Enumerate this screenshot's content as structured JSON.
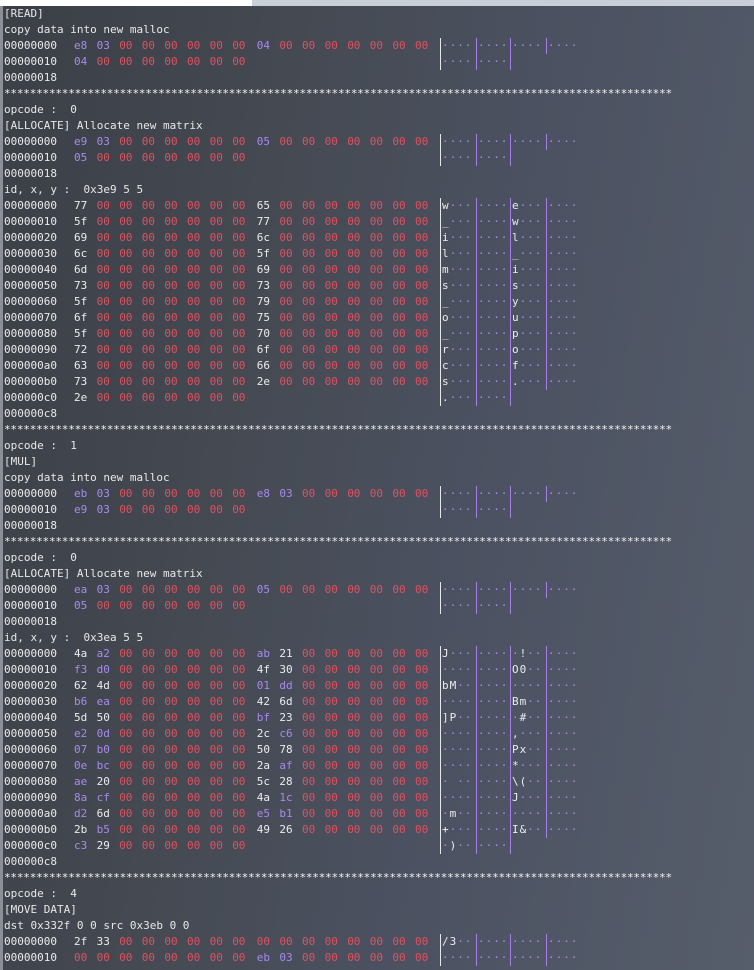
{
  "colors": {
    "zero": "#e0505e",
    "purple": "#a889ee",
    "white": "#ececec"
  },
  "lines": [
    {
      "type": "text",
      "text": "[READ]"
    },
    {
      "type": "text",
      "text": "copy data into new malloc"
    },
    {
      "type": "hex",
      "addr": "00000000",
      "bytes": [
        "e8",
        "03",
        "00",
        "00",
        "00",
        "00",
        "00",
        "00",
        "04",
        "00",
        "00",
        "00",
        "00",
        "00",
        "00",
        "00"
      ],
      "ascii": "................"
    },
    {
      "type": "hex",
      "addr": "00000010",
      "bytes": [
        "04",
        "00",
        "00",
        "00",
        "00",
        "00",
        "00",
        "00"
      ],
      "ascii": "........"
    },
    {
      "type": "text",
      "text": "00000018"
    },
    {
      "type": "stars"
    },
    {
      "type": "text",
      "text": "opcode :  0"
    },
    {
      "type": "text",
      "text": "[ALLOCATE] Allocate new matrix"
    },
    {
      "type": "hex",
      "addr": "00000000",
      "bytes": [
        "e9",
        "03",
        "00",
        "00",
        "00",
        "00",
        "00",
        "00",
        "05",
        "00",
        "00",
        "00",
        "00",
        "00",
        "00",
        "00"
      ],
      "ascii": "................"
    },
    {
      "type": "hex",
      "addr": "00000010",
      "bytes": [
        "05",
        "00",
        "00",
        "00",
        "00",
        "00",
        "00",
        "00"
      ],
      "ascii": "........"
    },
    {
      "type": "text",
      "text": "00000018"
    },
    {
      "type": "text",
      "text": "id, x, y :  0x3e9 5 5"
    },
    {
      "type": "hex",
      "addr": "00000000",
      "bytes": [
        "77",
        "00",
        "00",
        "00",
        "00",
        "00",
        "00",
        "00",
        "65",
        "00",
        "00",
        "00",
        "00",
        "00",
        "00",
        "00"
      ],
      "ascii": "w.......e......."
    },
    {
      "type": "hex",
      "addr": "00000010",
      "bytes": [
        "5f",
        "00",
        "00",
        "00",
        "00",
        "00",
        "00",
        "00",
        "77",
        "00",
        "00",
        "00",
        "00",
        "00",
        "00",
        "00"
      ],
      "ascii": "_.......w......."
    },
    {
      "type": "hex",
      "addr": "00000020",
      "bytes": [
        "69",
        "00",
        "00",
        "00",
        "00",
        "00",
        "00",
        "00",
        "6c",
        "00",
        "00",
        "00",
        "00",
        "00",
        "00",
        "00"
      ],
      "ascii": "i.......l......."
    },
    {
      "type": "hex",
      "addr": "00000030",
      "bytes": [
        "6c",
        "00",
        "00",
        "00",
        "00",
        "00",
        "00",
        "00",
        "5f",
        "00",
        "00",
        "00",
        "00",
        "00",
        "00",
        "00"
      ],
      "ascii": "l......._......."
    },
    {
      "type": "hex",
      "addr": "00000040",
      "bytes": [
        "6d",
        "00",
        "00",
        "00",
        "00",
        "00",
        "00",
        "00",
        "69",
        "00",
        "00",
        "00",
        "00",
        "00",
        "00",
        "00"
      ],
      "ascii": "m.......i......."
    },
    {
      "type": "hex",
      "addr": "00000050",
      "bytes": [
        "73",
        "00",
        "00",
        "00",
        "00",
        "00",
        "00",
        "00",
        "73",
        "00",
        "00",
        "00",
        "00",
        "00",
        "00",
        "00"
      ],
      "ascii": "s.......s......."
    },
    {
      "type": "hex",
      "addr": "00000060",
      "bytes": [
        "5f",
        "00",
        "00",
        "00",
        "00",
        "00",
        "00",
        "00",
        "79",
        "00",
        "00",
        "00",
        "00",
        "00",
        "00",
        "00"
      ],
      "ascii": "_.......y......."
    },
    {
      "type": "hex",
      "addr": "00000070",
      "bytes": [
        "6f",
        "00",
        "00",
        "00",
        "00",
        "00",
        "00",
        "00",
        "75",
        "00",
        "00",
        "00",
        "00",
        "00",
        "00",
        "00"
      ],
      "ascii": "o.......u......."
    },
    {
      "type": "hex",
      "addr": "00000080",
      "bytes": [
        "5f",
        "00",
        "00",
        "00",
        "00",
        "00",
        "00",
        "00",
        "70",
        "00",
        "00",
        "00",
        "00",
        "00",
        "00",
        "00"
      ],
      "ascii": "_.......p......."
    },
    {
      "type": "hex",
      "addr": "00000090",
      "bytes": [
        "72",
        "00",
        "00",
        "00",
        "00",
        "00",
        "00",
        "00",
        "6f",
        "00",
        "00",
        "00",
        "00",
        "00",
        "00",
        "00"
      ],
      "ascii": "r.......o......."
    },
    {
      "type": "hex",
      "addr": "000000a0",
      "bytes": [
        "63",
        "00",
        "00",
        "00",
        "00",
        "00",
        "00",
        "00",
        "66",
        "00",
        "00",
        "00",
        "00",
        "00",
        "00",
        "00"
      ],
      "ascii": "c.......f......."
    },
    {
      "type": "hex",
      "addr": "000000b0",
      "bytes": [
        "73",
        "00",
        "00",
        "00",
        "00",
        "00",
        "00",
        "00",
        "2e",
        "00",
        "00",
        "00",
        "00",
        "00",
        "00",
        "00"
      ],
      "ascii": "s..............."
    },
    {
      "type": "hex",
      "addr": "000000c0",
      "bytes": [
        "2e",
        "00",
        "00",
        "00",
        "00",
        "00",
        "00",
        "00"
      ],
      "ascii": "........"
    },
    {
      "type": "text",
      "text": "000000c8"
    },
    {
      "type": "stars"
    },
    {
      "type": "text",
      "text": "opcode :  1"
    },
    {
      "type": "text",
      "text": "[MUL]"
    },
    {
      "type": "text",
      "text": "copy data into new malloc"
    },
    {
      "type": "hex",
      "addr": "00000000",
      "bytes": [
        "eb",
        "03",
        "00",
        "00",
        "00",
        "00",
        "00",
        "00",
        "e8",
        "03",
        "00",
        "00",
        "00",
        "00",
        "00",
        "00"
      ],
      "ascii": "................"
    },
    {
      "type": "hex",
      "addr": "00000010",
      "bytes": [
        "e9",
        "03",
        "00",
        "00",
        "00",
        "00",
        "00",
        "00"
      ],
      "ascii": "........"
    },
    {
      "type": "text",
      "text": "00000018"
    },
    {
      "type": "stars"
    },
    {
      "type": "text",
      "text": "opcode :  0"
    },
    {
      "type": "text",
      "text": "[ALLOCATE] Allocate new matrix"
    },
    {
      "type": "hex",
      "addr": "00000000",
      "bytes": [
        "ea",
        "03",
        "00",
        "00",
        "00",
        "00",
        "00",
        "00",
        "05",
        "00",
        "00",
        "00",
        "00",
        "00",
        "00",
        "00"
      ],
      "ascii": "................"
    },
    {
      "type": "hex",
      "addr": "00000010",
      "bytes": [
        "05",
        "00",
        "00",
        "00",
        "00",
        "00",
        "00",
        "00"
      ],
      "ascii": "........"
    },
    {
      "type": "text",
      "text": "00000018"
    },
    {
      "type": "text",
      "text": "id, x, y :  0x3ea 5 5"
    },
    {
      "type": "hex",
      "addr": "00000000",
      "bytes": [
        "4a",
        "a2",
        "00",
        "00",
        "00",
        "00",
        "00",
        "00",
        "ab",
        "21",
        "00",
        "00",
        "00",
        "00",
        "00",
        "00"
      ],
      "ascii": "J........!......"
    },
    {
      "type": "hex",
      "addr": "00000010",
      "bytes": [
        "f3",
        "d0",
        "00",
        "00",
        "00",
        "00",
        "00",
        "00",
        "4f",
        "30",
        "00",
        "00",
        "00",
        "00",
        "00",
        "00"
      ],
      "ascii": "........O0......"
    },
    {
      "type": "hex",
      "addr": "00000020",
      "bytes": [
        "62",
        "4d",
        "00",
        "00",
        "00",
        "00",
        "00",
        "00",
        "01",
        "dd",
        "00",
        "00",
        "00",
        "00",
        "00",
        "00"
      ],
      "ascii": "bM.............."
    },
    {
      "type": "hex",
      "addr": "00000030",
      "bytes": [
        "b6",
        "ea",
        "00",
        "00",
        "00",
        "00",
        "00",
        "00",
        "42",
        "6d",
        "00",
        "00",
        "00",
        "00",
        "00",
        "00"
      ],
      "ascii": "........Bm......"
    },
    {
      "type": "hex",
      "addr": "00000040",
      "bytes": [
        "5d",
        "50",
        "00",
        "00",
        "00",
        "00",
        "00",
        "00",
        "bf",
        "23",
        "00",
        "00",
        "00",
        "00",
        "00",
        "00"
      ],
      "ascii": "]P.......#......"
    },
    {
      "type": "hex",
      "addr": "00000050",
      "bytes": [
        "e2",
        "0d",
        "00",
        "00",
        "00",
        "00",
        "00",
        "00",
        "2c",
        "c6",
        "00",
        "00",
        "00",
        "00",
        "00",
        "00"
      ],
      "ascii": "........,......."
    },
    {
      "type": "hex",
      "addr": "00000060",
      "bytes": [
        "07",
        "b0",
        "00",
        "00",
        "00",
        "00",
        "00",
        "00",
        "50",
        "78",
        "00",
        "00",
        "00",
        "00",
        "00",
        "00"
      ],
      "ascii": "........Px......"
    },
    {
      "type": "hex",
      "addr": "00000070",
      "bytes": [
        "0e",
        "bc",
        "00",
        "00",
        "00",
        "00",
        "00",
        "00",
        "2a",
        "af",
        "00",
        "00",
        "00",
        "00",
        "00",
        "00"
      ],
      "ascii": "........*......."
    },
    {
      "type": "hex",
      "addr": "00000080",
      "bytes": [
        "ae",
        "20",
        "00",
        "00",
        "00",
        "00",
        "00",
        "00",
        "5c",
        "28",
        "00",
        "00",
        "00",
        "00",
        "00",
        "00"
      ],
      "ascii": ". ......\\(......"
    },
    {
      "type": "hex",
      "addr": "00000090",
      "bytes": [
        "8a",
        "cf",
        "00",
        "00",
        "00",
        "00",
        "00",
        "00",
        "4a",
        "1c",
        "00",
        "00",
        "00",
        "00",
        "00",
        "00"
      ],
      "ascii": "........J......."
    },
    {
      "type": "hex",
      "addr": "000000a0",
      "bytes": [
        "d2",
        "6d",
        "00",
        "00",
        "00",
        "00",
        "00",
        "00",
        "e5",
        "b1",
        "00",
        "00",
        "00",
        "00",
        "00",
        "00"
      ],
      "ascii": ".m.............."
    },
    {
      "type": "hex",
      "addr": "000000b0",
      "bytes": [
        "2b",
        "b5",
        "00",
        "00",
        "00",
        "00",
        "00",
        "00",
        "49",
        "26",
        "00",
        "00",
        "00",
        "00",
        "00",
        "00"
      ],
      "ascii": "+.......I&......"
    },
    {
      "type": "hex",
      "addr": "000000c0",
      "bytes": [
        "c3",
        "29",
        "00",
        "00",
        "00",
        "00",
        "00",
        "00"
      ],
      "ascii": ".)......"
    },
    {
      "type": "text",
      "text": "000000c8"
    },
    {
      "type": "stars"
    },
    {
      "type": "text",
      "text": "opcode :  4"
    },
    {
      "type": "text",
      "text": "[MOVE DATA]"
    },
    {
      "type": "text",
      "text": "dst 0x332f 0 0 src 0x3eb 0 0"
    },
    {
      "type": "hex",
      "addr": "00000000",
      "bytes": [
        "2f",
        "33",
        "00",
        "00",
        "00",
        "00",
        "00",
        "00",
        "00",
        "00",
        "00",
        "00",
        "00",
        "00",
        "00",
        "00"
      ],
      "ascii": "/3.............."
    },
    {
      "type": "hex",
      "addr": "00000010",
      "bytes": [
        "00",
        "00",
        "00",
        "00",
        "00",
        "00",
        "00",
        "00",
        "eb",
        "03",
        "00",
        "00",
        "00",
        "00",
        "00",
        "00"
      ],
      "ascii": "................"
    }
  ]
}
